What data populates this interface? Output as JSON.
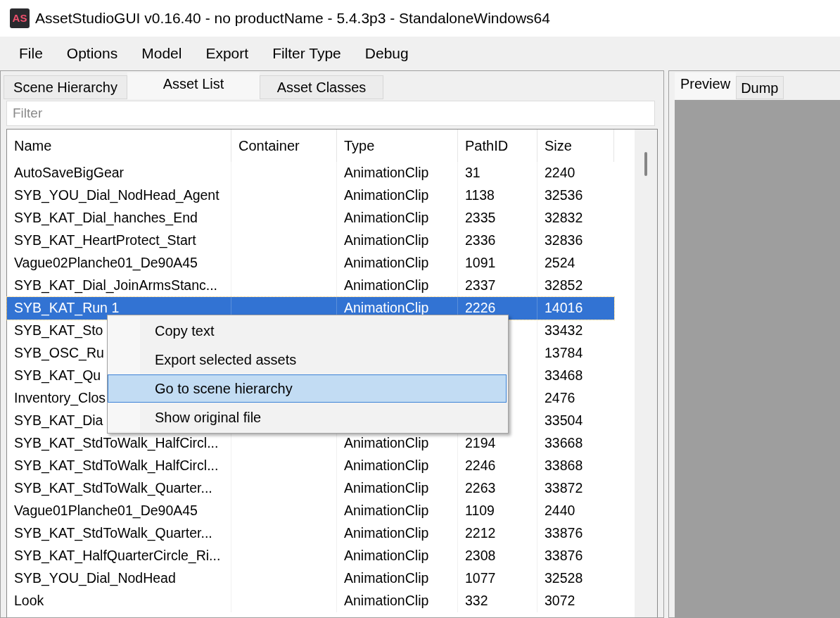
{
  "window": {
    "logo": "AS",
    "title": "AssetStudioGUI v0.16.40 - no productName - 5.4.3p3 - StandaloneWindows64"
  },
  "menu": [
    "File",
    "Options",
    "Model",
    "Export",
    "Filter Type",
    "Debug"
  ],
  "left_tabs": [
    {
      "label": "Scene Hierarchy",
      "selected": false
    },
    {
      "label": "Asset List",
      "selected": true
    },
    {
      "label": "Asset Classes",
      "selected": false
    }
  ],
  "filter": {
    "placeholder": "Filter"
  },
  "asset_table": {
    "columns": [
      "Name",
      "Container",
      "Type",
      "PathID",
      "Size"
    ],
    "rows": [
      {
        "name": "AutoSaveBigGear",
        "type": "AnimationClip",
        "path_id": "31",
        "size": "2240",
        "selected": false
      },
      {
        "name": "SYB_YOU_Dial_NodHead_Agent",
        "type": "AnimationClip",
        "path_id": "1138",
        "size": "32536",
        "selected": false
      },
      {
        "name": "SYB_KAT_Dial_hanches_End",
        "type": "AnimationClip",
        "path_id": "2335",
        "size": "32832",
        "selected": false
      },
      {
        "name": "SYB_KAT_HeartProtect_Start",
        "type": "AnimationClip",
        "path_id": "2336",
        "size": "32836",
        "selected": false
      },
      {
        "name": "Vague02Planche01_De90A45",
        "type": "AnimationClip",
        "path_id": "1091",
        "size": "2524",
        "selected": false
      },
      {
        "name": "SYB_KAT_Dial_JoinArmsStanc...",
        "type": "AnimationClip",
        "path_id": "2337",
        "size": "32852",
        "selected": false
      },
      {
        "name": "SYB_KAT_Run 1",
        "type": "AnimationClip",
        "path_id": "2226",
        "size": "14016",
        "selected": true
      },
      {
        "name": "SYB_KAT_Sto",
        "size": "33432",
        "selected": false
      },
      {
        "name": "SYB_OSC_Ru",
        "size": "13784",
        "selected": false
      },
      {
        "name": "SYB_KAT_Qu",
        "size": "33468",
        "selected": false
      },
      {
        "name": "Inventory_Clos",
        "size": "2476",
        "selected": false
      },
      {
        "name": "SYB_KAT_Dia",
        "size": "33504",
        "selected": false
      },
      {
        "name": "SYB_KAT_StdToWalk_HalfCircl...",
        "type": "AnimationClip",
        "path_id": "2194",
        "size": "33668",
        "selected": false
      },
      {
        "name": "SYB_KAT_StdToWalk_HalfCircl...",
        "type": "AnimationClip",
        "path_id": "2246",
        "size": "33868",
        "selected": false
      },
      {
        "name": "SYB_KAT_StdToWalk_Quarter...",
        "type": "AnimationClip",
        "path_id": "2263",
        "size": "33872",
        "selected": false
      },
      {
        "name": "Vague01Planche01_De90A45",
        "type": "AnimationClip",
        "path_id": "1109",
        "size": "2440",
        "selected": false
      },
      {
        "name": "SYB_KAT_StdToWalk_Quarter...",
        "type": "AnimationClip",
        "path_id": "2212",
        "size": "33876",
        "selected": false
      },
      {
        "name": "SYB_KAT_HalfQuarterCircle_Ri...",
        "type": "AnimationClip",
        "path_id": "2308",
        "size": "33876",
        "selected": false
      },
      {
        "name": "SYB_YOU_Dial_NodHead",
        "type": "AnimationClip",
        "path_id": "1077",
        "size": "32528",
        "selected": false
      },
      {
        "name": "Look",
        "type": "AnimationClip",
        "path_id": "332",
        "size": "3072",
        "selected": false
      }
    ]
  },
  "context_menu": {
    "items": [
      {
        "label": "Copy text",
        "selected": false
      },
      {
        "label": "Export selected assets",
        "selected": false
      },
      {
        "label": "Go to scene hierarchy",
        "selected": true
      },
      {
        "label": "Show original file",
        "selected": false
      }
    ]
  },
  "right_tabs": [
    {
      "label": "Preview",
      "selected": true
    },
    {
      "label": "Dump",
      "selected": false
    }
  ]
}
